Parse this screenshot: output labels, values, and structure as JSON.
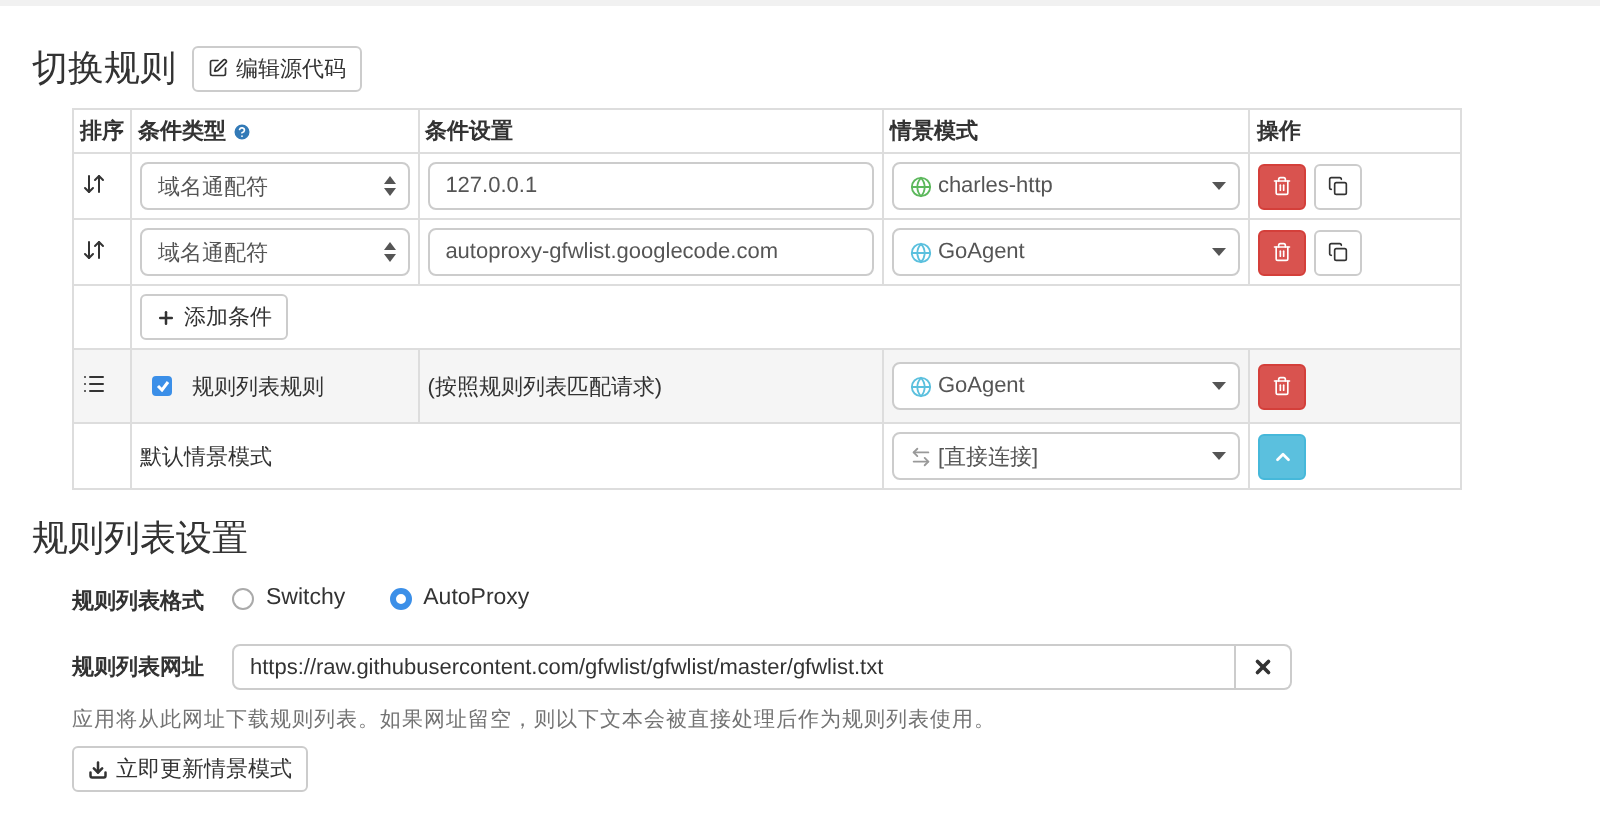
{
  "header": {
    "title": "切换规则",
    "edit_button": "编辑源代码"
  },
  "table": {
    "columns": [
      "排序",
      "条件类型",
      "条件设置",
      "情景模式",
      "操作"
    ],
    "rules": [
      {
        "condition_type": "域名通配符",
        "condition": "127.0.0.1",
        "profile": "charles-http",
        "color": "#5cb85c"
      },
      {
        "condition_type": "域名通配符",
        "condition": "autoproxy-gfwlist.googlecode.com",
        "profile": "GoAgent",
        "color": "#5bc0de"
      }
    ],
    "add_button": "添加条件",
    "rule_list_row": {
      "checked": true,
      "label": "规则列表规则",
      "condition": "(按照规则列表匹配请求)",
      "profile": "GoAgent",
      "color": "#5bc0de"
    },
    "default_row": {
      "label": "默认情景模式",
      "profile": "[直接连接]"
    }
  },
  "rule_list_settings": {
    "title": "规则列表设置",
    "format_label": "规则列表格式",
    "formats": [
      {
        "label": "Switchy",
        "selected": false
      },
      {
        "label": "AutoProxy",
        "selected": true
      }
    ],
    "url_label": "规则列表网址",
    "url": "https://raw.githubusercontent.com/gfwlist/gfwlist/master/gfwlist.txt",
    "help": "应用将从此网址下载规则列表。如果网址留空，则以下文本会被直接处理后作为规则列表使用。",
    "update_button": "立即更新情景模式"
  }
}
